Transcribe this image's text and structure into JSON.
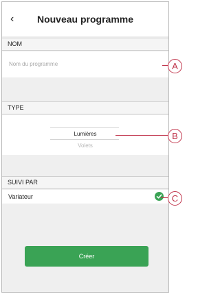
{
  "header": {
    "back_icon": "chevron-left-icon",
    "title": "Nouveau programme"
  },
  "name_section": {
    "label": "NOM",
    "placeholder": "Nom du programme"
  },
  "type_section": {
    "label": "TYPE",
    "options": [
      "Lumières",
      "Volets"
    ],
    "selected": "Lumières"
  },
  "follow_section": {
    "label": "SUIVI PAR",
    "item": "Variateur",
    "checked": true
  },
  "button": {
    "label": "Créer"
  },
  "callouts": [
    "A",
    "B",
    "C"
  ],
  "colors": {
    "accent": "#3aa355",
    "callout": "#c0344b"
  }
}
